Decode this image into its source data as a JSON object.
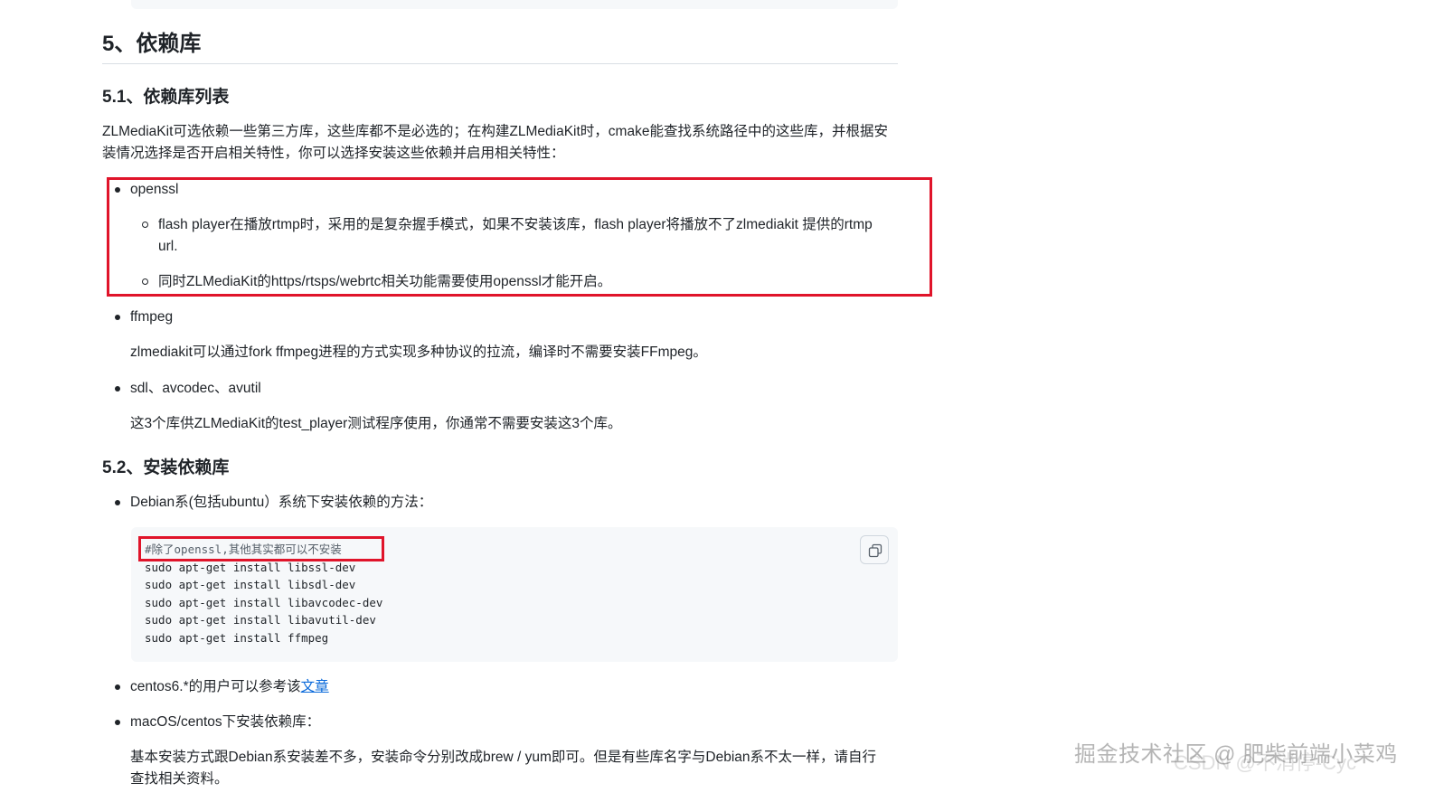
{
  "heading_main": "5、依赖库",
  "section_51": {
    "title": "5.1、依赖库列表",
    "intro_line1": "ZLMediaKit可选依赖一些第三方库，这些库都不是必选的；在构建ZLMediaKit时，cmake能查找系统路径中的这些库，并根据安",
    "intro_line2": "装情况选择是否开启相关特性，你可以选择安装这些依赖并启用相关特性："
  },
  "deps": {
    "openssl": {
      "name": "openssl",
      "sub1_line1": "flash player在播放rtmp时，采用的是复杂握手模式，如果不安装该库，flash player将播放不了zlmediakit 提供的rtmp",
      "sub1_line2": "url.",
      "sub2": "同时ZLMediaKit的https/rtsps/webrtc相关功能需要使用openssl才能开启。"
    },
    "ffmpeg": {
      "name": "ffmpeg",
      "desc": "zlmediakit可以通过fork ffmpeg进程的方式实现多种协议的拉流，编译时不需要安装FFmpeg。"
    },
    "sdl": {
      "name": "sdl、avcodec、avutil",
      "desc": "这3个库供ZLMediaKit的test_player测试程序使用，你通常不需要安装这3个库。"
    }
  },
  "section_52": {
    "title": "5.2、安装依赖库",
    "debian_item": "Debian系(包括ubuntu）系统下安装依赖的方法：",
    "code": [
      "#除了openssl,其他其实都可以不安装",
      "sudo apt-get install libssl-dev",
      "sudo apt-get install libsdl-dev",
      "sudo apt-get install libavcodec-dev",
      "sudo apt-get install libavutil-dev",
      "sudo apt-get install ffmpeg"
    ],
    "centos_prefix": "centos6.*的用户可以参考该",
    "centos_link": "文章",
    "macos_item": "macOS/centos下安装依赖库：",
    "macos_desc_line1": "基本安装方式跟Debian系安装差不多，安装命令分别改成brew / yum即可。但是有些库名字与Debian系不太一样，请自行",
    "macos_desc_line2": "查找相关资料。"
  },
  "watermark": {
    "main": "掘金技术社区 @ 肥柴前端小菜鸡",
    "secondary": "CSDN @不消停-Cyc"
  },
  "colors": {
    "highlight_red": "#e0142a",
    "link_blue": "#0969da",
    "code_bg": "#f6f8fa"
  }
}
